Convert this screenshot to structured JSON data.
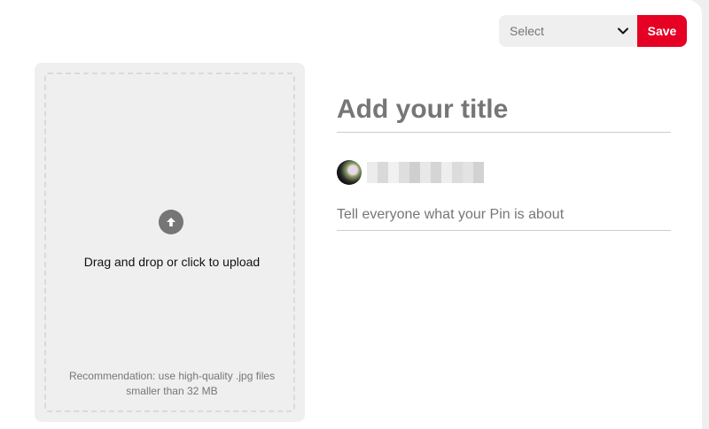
{
  "header": {
    "board_select": {
      "selected_label": "Select",
      "icon": "chevron-down-icon"
    },
    "save_label": "Save",
    "accent_color": "#e60023"
  },
  "upload": {
    "icon": "arrow-up-icon",
    "instruction": "Drag and drop or click to upload",
    "recommendation": "Recommendation: use high-quality .jpg files smaller than 32 MB"
  },
  "pin_form": {
    "title_placeholder": "Add your title",
    "title_value": "",
    "description_placeholder": "Tell everyone what your Pin is about",
    "description_value": "",
    "author": {
      "avatar": "user-avatar",
      "username_redacted": true
    }
  }
}
